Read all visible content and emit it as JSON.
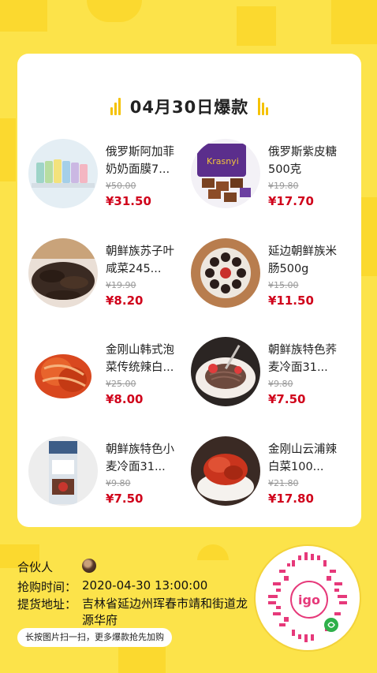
{
  "card": {
    "title": "04月30日爆款"
  },
  "products": [
    {
      "name": "俄罗斯阿加菲奶奶面膜7...",
      "original_price": "¥50.00",
      "price": "¥31.50"
    },
    {
      "name": "俄罗斯紫皮糖500克",
      "original_price": "¥19.80",
      "price": "¥17.70"
    },
    {
      "name": "朝鲜族苏子叶咸菜245...",
      "original_price": "¥19.90",
      "price": "¥8.20"
    },
    {
      "name": "延边朝鲜族米肠500g",
      "original_price": "¥15.00",
      "price": "¥11.50"
    },
    {
      "name": "金刚山韩式泡菜传统辣白...",
      "original_price": "¥25.00",
      "price": "¥8.00"
    },
    {
      "name": "朝鲜族特色荞麦冷面31...",
      "original_price": "¥9.80",
      "price": "¥7.50"
    },
    {
      "name": "朝鲜族特色小麦冷面31...",
      "original_price": "¥9.80",
      "price": "¥7.50"
    },
    {
      "name": "金刚山云浦辣白菜100...",
      "original_price": "¥21.80",
      "price": "¥17.80"
    }
  ],
  "footer": {
    "partner_label": "合伙人",
    "time_label": "抢购时间：",
    "time_value": "2020-04-30 13:00:00",
    "address_label": "提货地址：",
    "address_value": "吉林省延边州珲春市靖和街道龙源华府",
    "hint": "长按图片扫一扫，更多爆款抢先加购",
    "qr_logo_text": "igo"
  },
  "colors": {
    "background": "#FCE34A",
    "accent": "#F5C200",
    "price": "#D0021B"
  }
}
